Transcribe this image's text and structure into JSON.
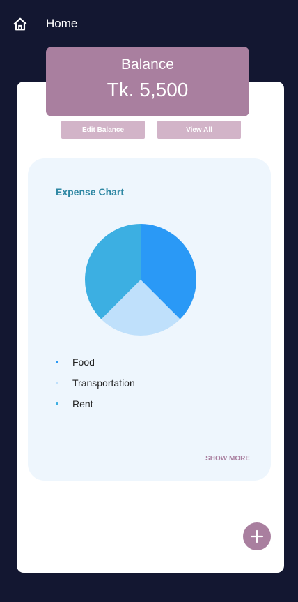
{
  "header": {
    "title": "Home",
    "icon": "home-icon"
  },
  "balance": {
    "label": "Balance",
    "value": "Tk. 5,500"
  },
  "actions": {
    "edit_label": "Edit Balance",
    "view_label": "View All"
  },
  "expense": {
    "title": "Expense Chart",
    "show_more_label": "SHOW MORE"
  },
  "chart_data": {
    "type": "pie",
    "categories": [
      "Food",
      "Transportation",
      "Rent"
    ],
    "values": [
      37.5,
      25,
      37.5
    ],
    "colors": [
      "#2a99f6",
      "#bfe0fb",
      "#3cafe2"
    ],
    "legend_position": "bottom-left"
  },
  "colors": {
    "background": "#131731",
    "accent": "#a97f9f",
    "button_light": "#d2b4c8",
    "panel": "#eef6fd",
    "chart_title": "#2e87a3"
  },
  "fab": {
    "icon": "plus-icon"
  }
}
